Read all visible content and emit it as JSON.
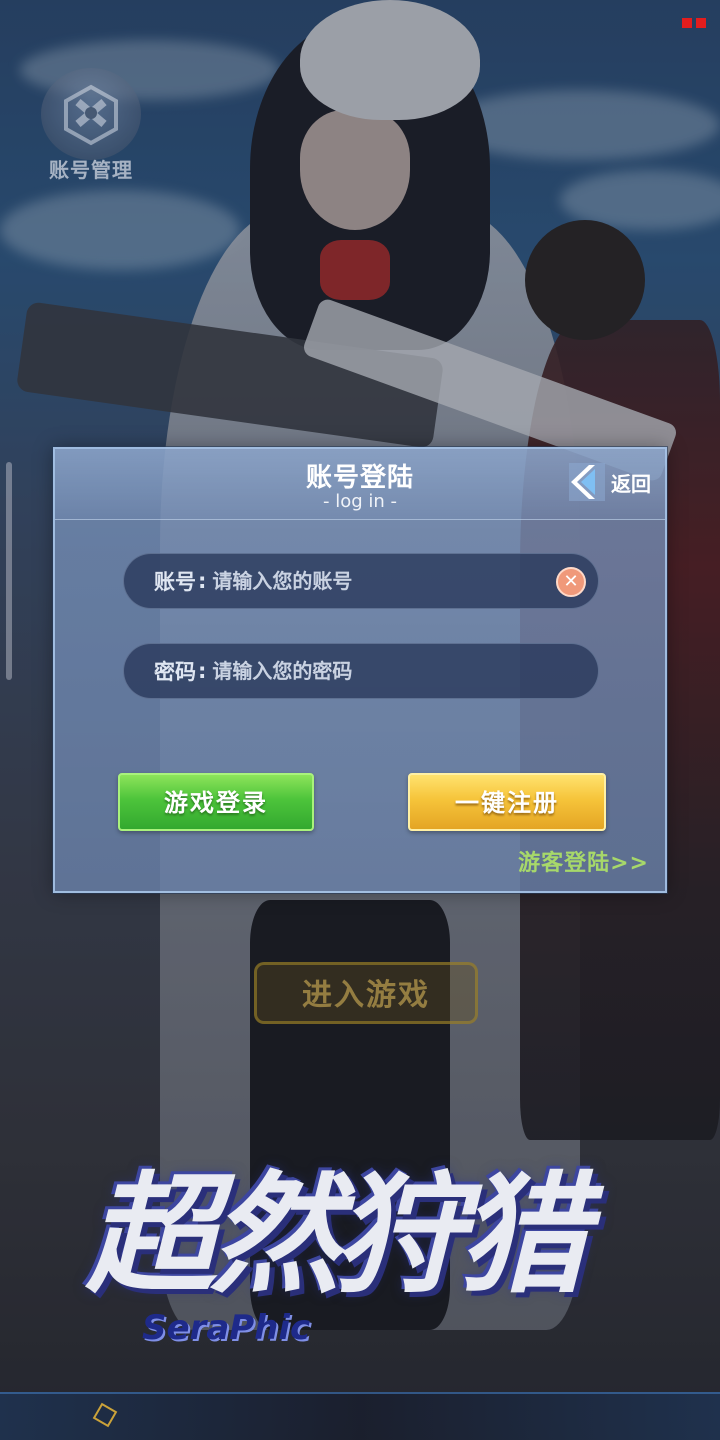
{
  "background": {
    "enter_game_label": "进入游戏",
    "logo_title": "超然狩猎",
    "logo_subtitle": "SeraPhic"
  },
  "account_manage": {
    "label": "账号管理",
    "icon": "wrench-hammer-icon"
  },
  "login_dialog": {
    "title": "账号登陆",
    "subtitle": "- log in -",
    "back_label": "返回",
    "account_field": {
      "label": "账号",
      "placeholder": "请输入您的账号",
      "value": ""
    },
    "password_field": {
      "label": "密码",
      "placeholder": "请输入您的密码",
      "value": ""
    },
    "login_button": "游戏登录",
    "register_button": "一键注册",
    "guest_link": "游客登陆>>"
  },
  "colors": {
    "login_green": "#4dc43b",
    "register_gold": "#f6c43a",
    "guest_link": "#a7d86a",
    "clear_button": "#f0997a",
    "record_indicator": "#e21d1d"
  }
}
